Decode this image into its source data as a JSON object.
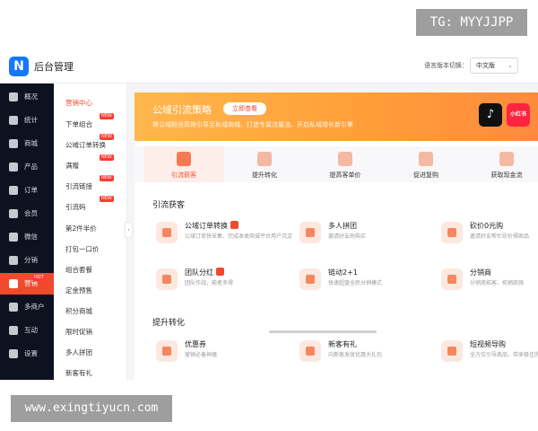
{
  "watermark_top": "TG: MYYJJPP",
  "watermark_bottom": "www.exingtiyucn.com",
  "header": {
    "app_title": "后台管理",
    "lang_label": "语言版本切换：",
    "lang_value": "中文版"
  },
  "sidebar": {
    "items": [
      {
        "label": "概况",
        "icon": "overview-icon"
      },
      {
        "label": "统计",
        "icon": "stats-icon"
      },
      {
        "label": "商城",
        "icon": "shop-icon"
      },
      {
        "label": "产品",
        "icon": "product-icon"
      },
      {
        "label": "订单",
        "icon": "order-icon"
      },
      {
        "label": "会员",
        "icon": "member-icon"
      },
      {
        "label": "微信",
        "icon": "wechat-icon"
      },
      {
        "label": "分销",
        "icon": "distribution-icon"
      },
      {
        "label": "营销",
        "icon": "marketing-icon",
        "badge": "HOT"
      },
      {
        "label": "多商户",
        "icon": "merchants-icon"
      },
      {
        "label": "互动",
        "icon": "interaction-icon"
      },
      {
        "label": "设置",
        "icon": "settings-icon"
      }
    ]
  },
  "submenu": {
    "items": [
      {
        "label": "营销中心"
      },
      {
        "label": "下单组合",
        "badge": "NEW"
      },
      {
        "label": "公域订单转换",
        "badge": "NEW"
      },
      {
        "label": "满赠",
        "badge": "NEW"
      },
      {
        "label": "引流链接",
        "badge": "NEW"
      },
      {
        "label": "引流码",
        "badge": "NEW"
      },
      {
        "label": "第2件半价"
      },
      {
        "label": "打包一口价"
      },
      {
        "label": "组合套餐"
      },
      {
        "label": "定金预售"
      },
      {
        "label": "积分商城"
      },
      {
        "label": "限时促销"
      },
      {
        "label": "多人拼团"
      },
      {
        "label": "新客有礼"
      }
    ]
  },
  "banner": {
    "title": "公域引流策略",
    "button": "立即查看",
    "subtitle": "将公域粉丝高效引导至私域商城、打造专属流量池、开启私域增长新引擎",
    "brand_1": "♪",
    "brand_2": "小红书"
  },
  "tabs": [
    {
      "label": "引流获客"
    },
    {
      "label": "提升转化"
    },
    {
      "label": "提高客单价"
    },
    {
      "label": "促进复购"
    },
    {
      "label": "获取现金流"
    }
  ],
  "sections": {
    "acquire": {
      "title": "引流获客",
      "cards": [
        {
          "title": "公域订单转换",
          "desc": "公域订单快采集，完成本类商城平台用户沉淀",
          "icon": "order-convert-icon"
        },
        {
          "title": "多人拼团",
          "desc": "邀请好友助购买",
          "icon": "group-buy-icon"
        },
        {
          "title": "砍价0元购",
          "desc": "邀请好友帮忙砍价得商品",
          "icon": "bargain-icon"
        },
        {
          "title": "团队分红",
          "desc": "团队作战，能者多得",
          "icon": "team-bonus-icon"
        },
        {
          "title": "链动2+1",
          "desc": "快速超盘全民分销模式",
          "icon": "chain-icon"
        },
        {
          "title": "分销商",
          "desc": "分销商拓客，拓销商强",
          "icon": "distributor-icon"
        }
      ]
    },
    "convert": {
      "title": "提升转化",
      "cards": [
        {
          "title": "优惠券",
          "desc": "营销必备神器",
          "icon": "coupon-icon"
        },
        {
          "title": "新客有礼",
          "desc": "向新客发放优惠大礼包",
          "icon": "new-customer-gift-icon"
        },
        {
          "title": "短视频导购",
          "desc": "全方位引导商品，带来极佳的购物体验",
          "icon": "short-video-icon"
        }
      ]
    }
  },
  "colors": {
    "accent": "#f04a2e",
    "sidebar_bg": "#0e1220",
    "banner_start": "#ffb74d",
    "banner_end": "#ff8a3d"
  }
}
